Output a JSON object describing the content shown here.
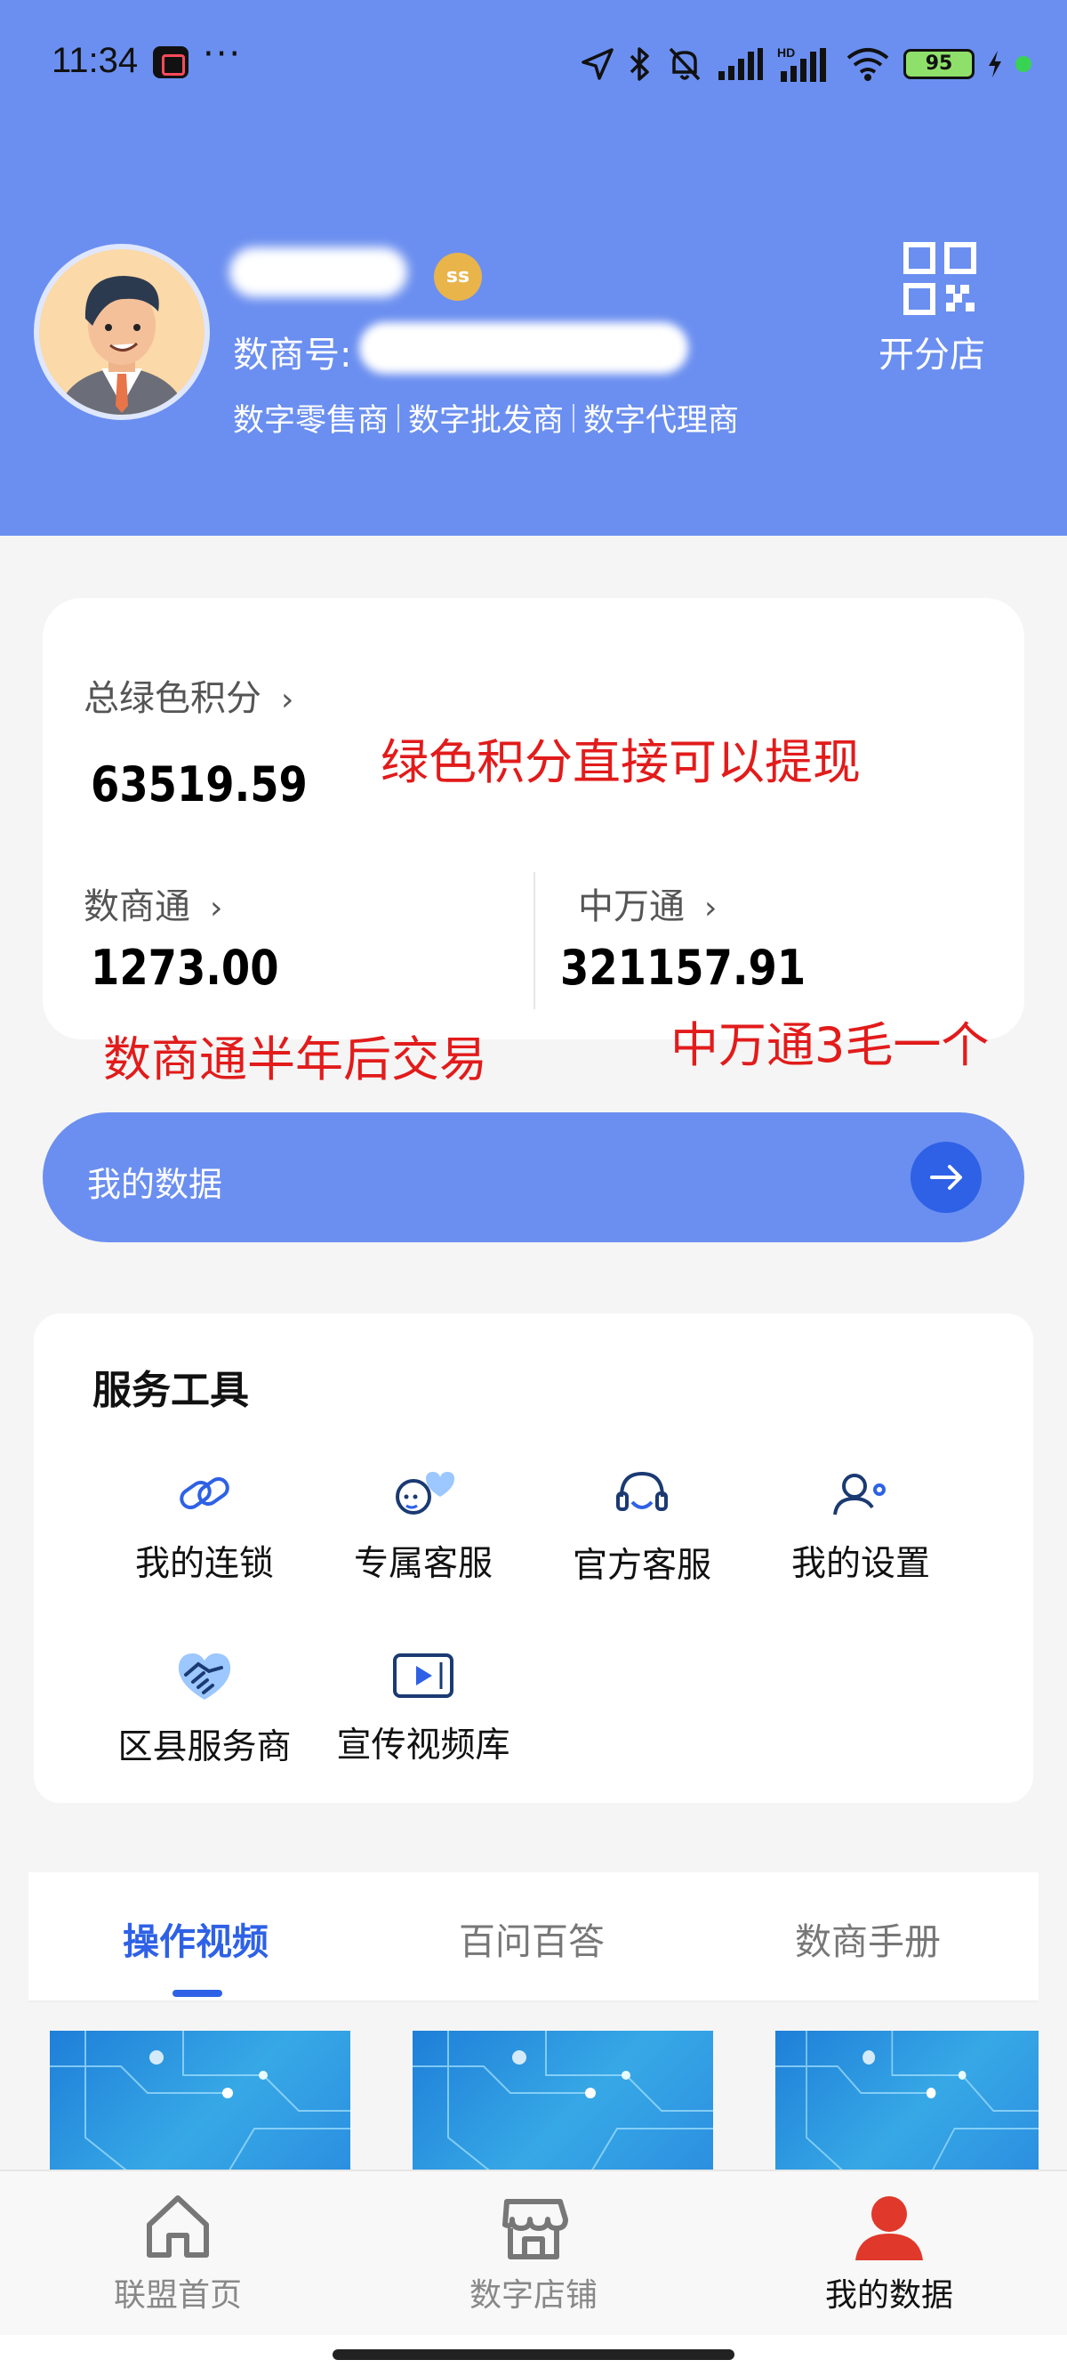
{
  "status": {
    "time": "11:34",
    "more": "···",
    "battery": "95"
  },
  "profile": {
    "badge": "ss",
    "id_label": "数商号:",
    "roles": [
      "数字零售商",
      "数字批发商",
      "数字代理商"
    ],
    "open_branch": "开分店",
    "qr_icon": "qr-code-icon"
  },
  "points": {
    "total_label": "总绿色积分",
    "total_value": "63519.59",
    "shushang_label": "数商通",
    "shushang_value": "1273.00",
    "zhongwan_label": "中万通",
    "zhongwan_value": "321157.91"
  },
  "annotations": {
    "note1": "绿色积分直接可以提现",
    "note2": "数商通半年后交易",
    "note3": "中万通3毛一个",
    "color": "#e21b1b"
  },
  "mydata_bar": {
    "label": "我的数据"
  },
  "tools": {
    "title": "服务工具",
    "items": [
      {
        "label": "我的连锁",
        "icon": "chain-link-icon"
      },
      {
        "label": "专属客服",
        "icon": "chat-heart-icon"
      },
      {
        "label": "官方客服",
        "icon": "headset-icon"
      },
      {
        "label": "我的设置",
        "icon": "user-settings-icon"
      },
      {
        "label": "区县服务商",
        "icon": "handshake-icon"
      },
      {
        "label": "宣传视频库",
        "icon": "video-play-icon"
      }
    ]
  },
  "tabs": [
    "操作视频",
    "百问百答",
    "数商手册"
  ],
  "bottom_nav": [
    {
      "label": "联盟首页",
      "icon": "home-icon"
    },
    {
      "label": "数字店铺",
      "icon": "store-icon"
    },
    {
      "label": "我的数据",
      "icon": "user-icon"
    }
  ],
  "colors": {
    "brand": "#6b8ff0",
    "accent": "#2e61e6",
    "active_user": "#e0382b"
  }
}
